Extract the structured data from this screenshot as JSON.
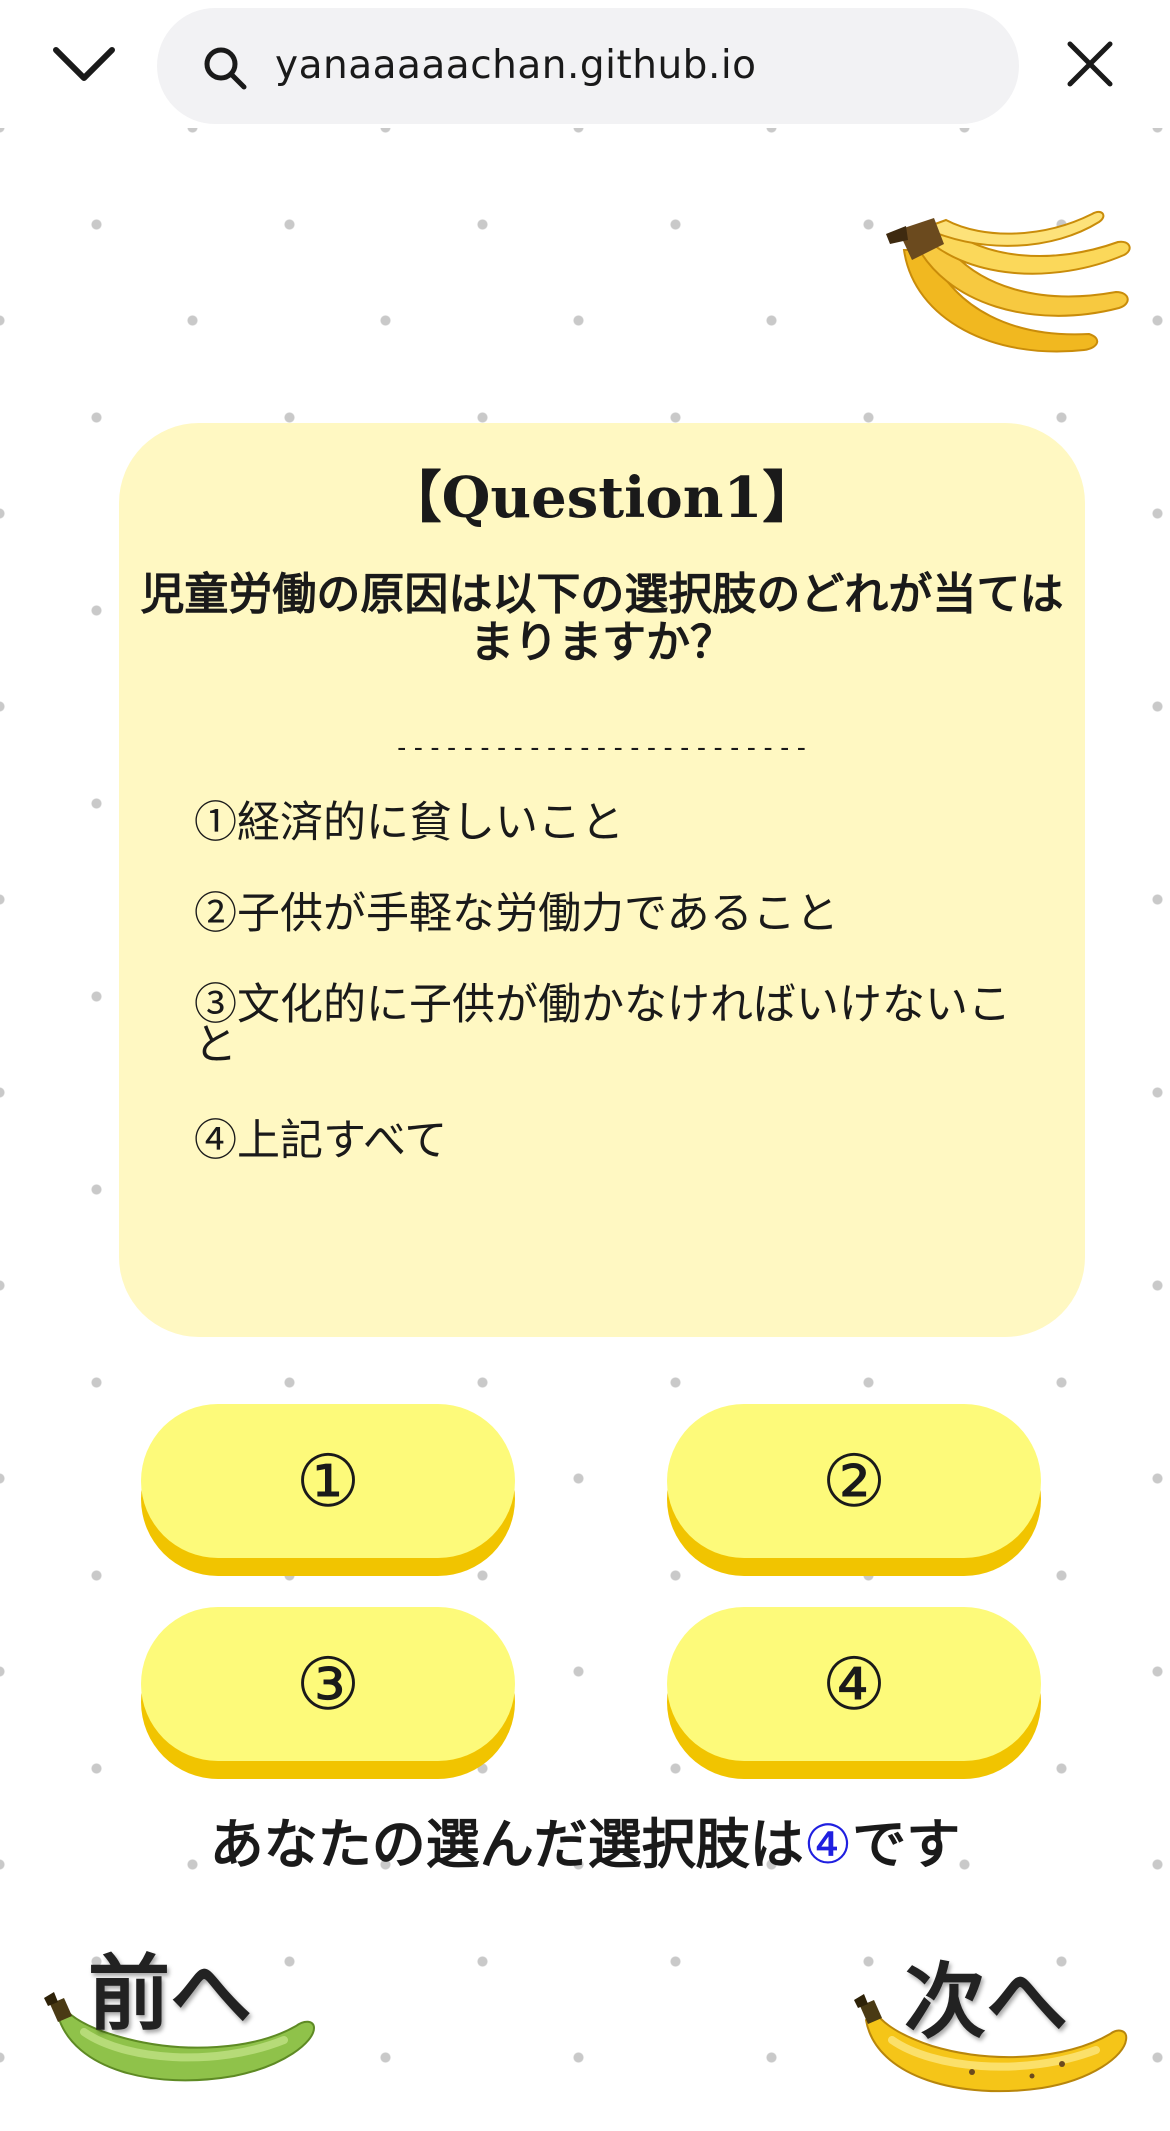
{
  "browser": {
    "url": "yanaaaaachan.github.io",
    "icons": {
      "collapse": "chevron-down-icon",
      "search": "search-icon",
      "close": "close-icon"
    }
  },
  "quiz": {
    "title": "【Question1】",
    "question": "児童労働の原因は以下の選択肢のどれが当てはまりますか？",
    "separator": "-------------------------",
    "options": [
      "①経済的に貧しいこと",
      "②子供が手軽な労働力であること",
      "③文化的に子供が働かなければいけないこと",
      "④上記すべて"
    ]
  },
  "answer_buttons": [
    "①",
    "②",
    "③",
    "④"
  ],
  "selection": {
    "prefix": "あなたの選んだ選択肢は",
    "value": "④",
    "suffix": "です"
  },
  "navigation": {
    "prev_label": "前へ",
    "next_label": "次へ"
  },
  "colors": {
    "card_background": "#fff8c2",
    "button_face": "#fdfa7a",
    "button_shadow": "#f1c400",
    "selected_value": "#1f1fe0",
    "dot": "#c9c9c9"
  }
}
